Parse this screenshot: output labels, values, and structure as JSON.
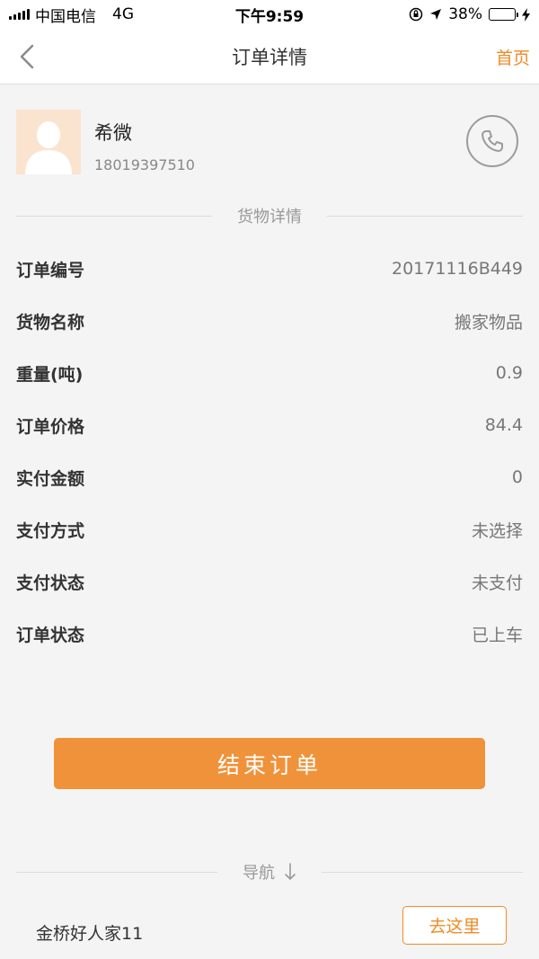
{
  "status_bar": {
    "carrier": "中国电信",
    "network": "4G",
    "time": "下午9:59",
    "battery": "38%",
    "battery_level": 0.38,
    "icons": [
      "signal-icon",
      "lock-rotation-icon",
      "location-arrow-icon",
      "battery-icon",
      "charging-icon"
    ]
  },
  "nav": {
    "title": "订单详情",
    "home": "首页",
    "back_icon": "chevron-left-icon"
  },
  "contact": {
    "name": "希微",
    "phone": "18019397510",
    "call_icon": "phone-icon"
  },
  "section_title": "货物详情",
  "details": [
    {
      "label": "订单编号",
      "value": "20171116B449"
    },
    {
      "label": "货物名称",
      "value": "搬家物品"
    },
    {
      "label": "重量(吨)",
      "value": "0.9"
    },
    {
      "label": "订单价格",
      "value": "84.4"
    },
    {
      "label": "实付金额",
      "value": "0"
    },
    {
      "label": "支付方式",
      "value": "未选择"
    },
    {
      "label": "支付状态",
      "value": "未支付"
    },
    {
      "label": "订单状态",
      "value": "已上车"
    }
  ],
  "end_order_label": "结束订单",
  "navigation": {
    "title": "导航",
    "arrow_icon": "arrow-down-icon",
    "destination": "金桥好人家11",
    "go_label": "去这里"
  },
  "colors": {
    "accent": "#f08a24",
    "button": "#f0923a",
    "background": "#f4f4f4"
  }
}
